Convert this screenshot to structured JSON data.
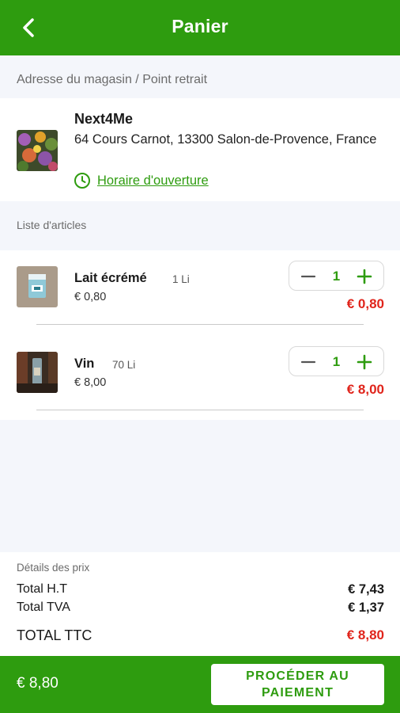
{
  "header": {
    "title": "Panier",
    "back_icon": "chevron-left-icon"
  },
  "store": {
    "section_label": "Adresse du magasin / Point retrait",
    "name": "Next4Me",
    "address": "64 Cours Carnot, 13300 Salon-de-Provence, France",
    "hours_icon": "clock-icon",
    "hours_link": "Horaire d'ouverture"
  },
  "items_section_label": "Liste d'articles",
  "items": [
    {
      "name": "Lait écrémé",
      "volume": "1 Li",
      "unit_price": "€ 0,80",
      "quantity": "1",
      "total": "€ 0,80"
    },
    {
      "name": "Vin",
      "volume": "70 Li",
      "unit_price": "€ 8,00",
      "quantity": "1",
      "total": "€ 8,00"
    }
  ],
  "price_details": {
    "label": "Détails des prix",
    "total_ht_label": "Total H.T",
    "total_ht_value": "€ 7,43",
    "total_tva_label": "Total TVA",
    "total_tva_value": "€ 1,37",
    "total_ttc_label": "TOTAL TTC",
    "total_ttc_value": "€ 8,80"
  },
  "footer": {
    "total": "€ 8,80",
    "pay_button": "PROCÉDER AU\nPAIEMENT"
  },
  "colors": {
    "brand_green": "#2e9c0f",
    "price_red": "#e0241b",
    "background": "#f4f6fb"
  }
}
